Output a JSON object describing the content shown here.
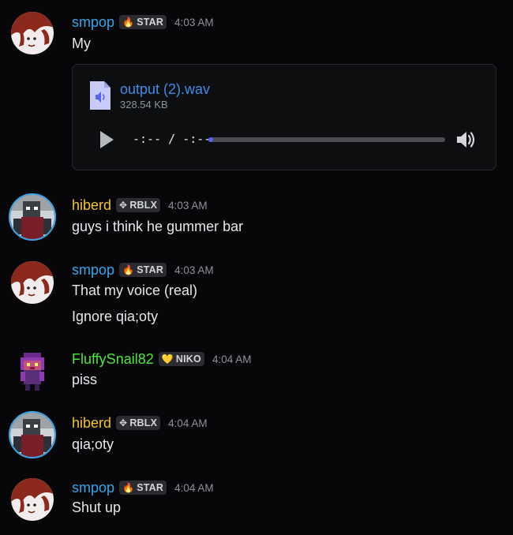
{
  "colors": {
    "smpop": "#3aa5e8",
    "hiberd": "#f1c232",
    "fluffy": "#4fe63c",
    "link": "#3b8eea",
    "progress_accent": "#5865f2"
  },
  "messages": [
    {
      "username": "smpop",
      "tag": {
        "icon": "flame-icon",
        "label": "STAR"
      },
      "time": "4:03 AM",
      "lines": [
        "My"
      ],
      "attachment": {
        "icon": "audio-file-icon",
        "filename": "output (2).wav",
        "size": "328.54 KB",
        "time_display": "-:-- / -:--",
        "progress": 0
      }
    },
    {
      "username": "hiberd",
      "tag": {
        "icon": "move-arrows-icon",
        "label": "RBLX"
      },
      "time": "4:03 AM",
      "lines": [
        "guys i think he gummer bar"
      ]
    },
    {
      "username": "smpop",
      "tag": {
        "icon": "flame-icon",
        "label": "STAR"
      },
      "time": "4:03 AM",
      "lines": [
        "That my voice (real)",
        "Ignore qia;oty"
      ]
    },
    {
      "username": "FluffySnail82",
      "tag": {
        "icon": "yellow-heart-icon",
        "label": "NIKO"
      },
      "time": "4:04 AM",
      "lines": [
        "piss"
      ]
    },
    {
      "username": "hiberd",
      "tag": {
        "icon": "move-arrows-icon",
        "label": "RBLX"
      },
      "time": "4:04 AM",
      "lines": [
        "qia;oty"
      ]
    },
    {
      "username": "smpop",
      "tag": {
        "icon": "flame-icon",
        "label": "STAR"
      },
      "time": "4:04 AM",
      "lines": [
        "Shut up"
      ]
    }
  ]
}
